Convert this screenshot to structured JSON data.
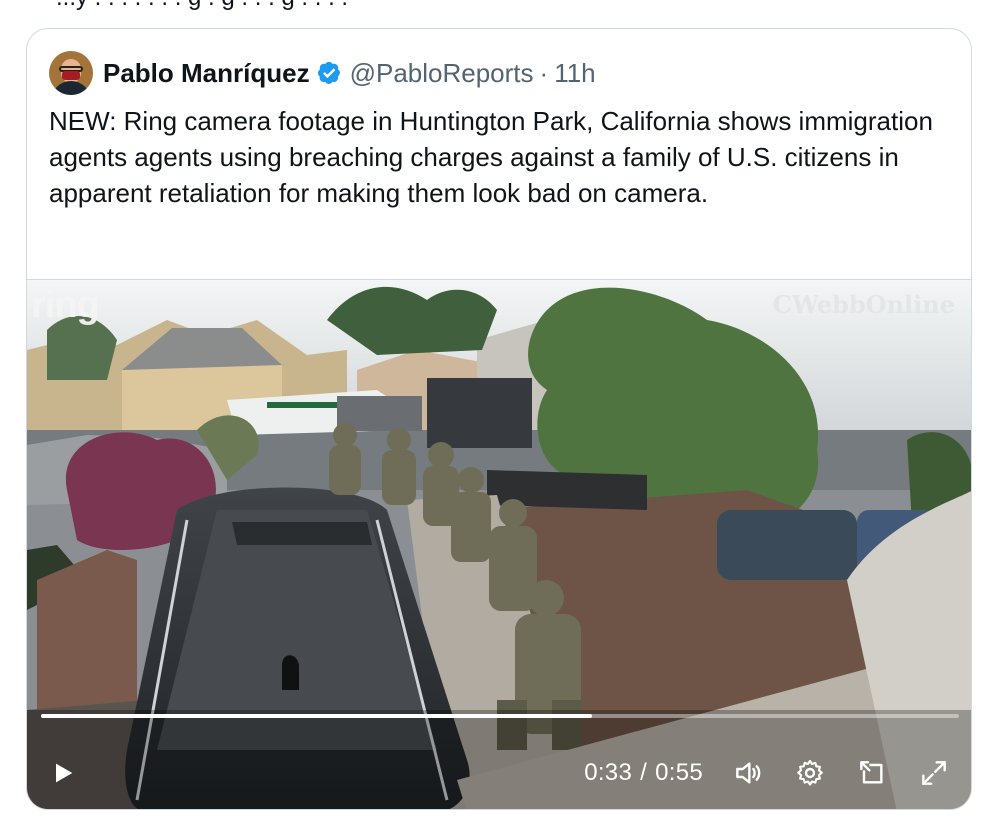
{
  "top": {
    "text": "...y . . . . . . . g . g . . . g . . . ."
  },
  "tweet": {
    "author_name": "Pablo Manríquez",
    "handle": "@PabloReports",
    "separator": "·",
    "time": "11h",
    "text": "NEW: Ring camera footage in Huntington Park, California shows immigration agents agents using breaching charges against a family of U.S. citizens in apparent retaliation for making them look bad on camera."
  },
  "media": {
    "overlay_logo": "ring",
    "watermark": "CWebbOnline",
    "progress": 0.6,
    "time_current": "0:33",
    "time_separator": "/",
    "time_total": "0:55"
  },
  "icons": {
    "avatar": "avatar",
    "verified": "verified-badge-icon",
    "play": "play-icon",
    "volume": "volume-icon",
    "settings": "gear-icon",
    "popout": "popout-icon",
    "fullscreen": "fullscreen-icon"
  },
  "colors": {
    "accent": "#1d9bf0",
    "text_primary": "#0f1419",
    "text_secondary": "#536471",
    "border": "#cfd9de"
  }
}
